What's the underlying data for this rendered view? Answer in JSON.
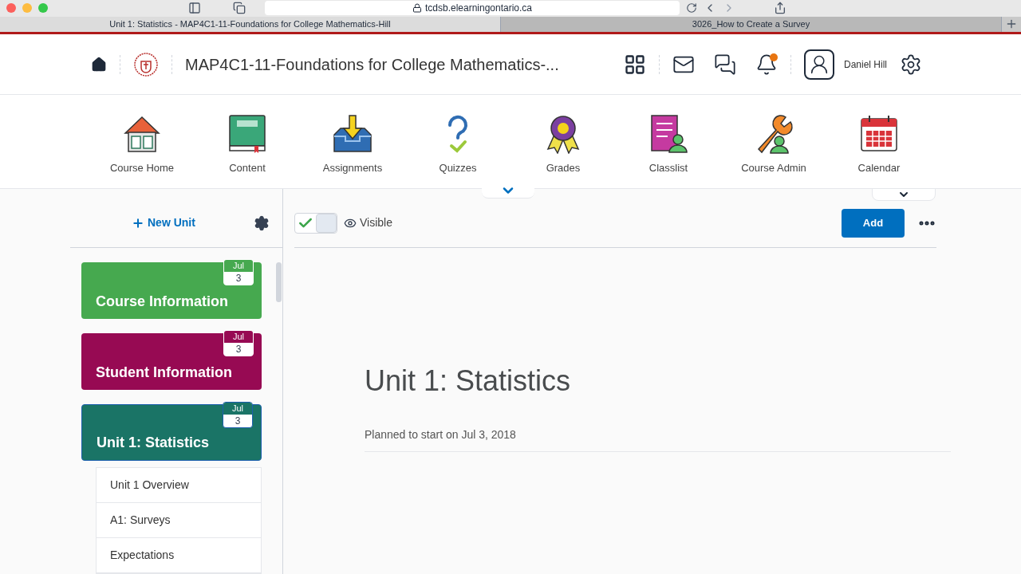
{
  "browser": {
    "address": "tcdsb.elearningontario.ca",
    "tabs": [
      {
        "label": "Unit 1: Statistics - MAP4C1-11-Foundations for College Mathematics-Hill",
        "selected": true
      },
      {
        "label": "3026_How to Create a Survey",
        "selected": false
      }
    ]
  },
  "header": {
    "course_title": "MAP4C1-11-Foundations for College Mathematics-...",
    "user_name": "Daniel Hill",
    "notification_unread": true
  },
  "nav": [
    {
      "kind": "home",
      "label": "Course Home"
    },
    {
      "kind": "content",
      "label": "Content"
    },
    {
      "kind": "assignments",
      "label": "Assignments"
    },
    {
      "kind": "quizzes",
      "label": "Quizzes"
    },
    {
      "kind": "grades",
      "label": "Grades"
    },
    {
      "kind": "classlist",
      "label": "Classlist"
    },
    {
      "kind": "admin",
      "label": "Course Admin"
    },
    {
      "kind": "calendar",
      "label": "Calendar"
    }
  ],
  "sidebar": {
    "new_unit": "New Unit",
    "units": [
      {
        "title": "Course Information",
        "month": "Jul",
        "day": "3",
        "color": "#46a94f",
        "selected": false
      },
      {
        "title": "Student Information",
        "month": "Jul",
        "day": "3",
        "color": "#970a53",
        "selected": false
      },
      {
        "title": "Unit 1: Statistics",
        "month": "Jul",
        "day": "3",
        "color": "#1a7466",
        "selected": true
      }
    ],
    "items": [
      "Unit 1 Overview",
      "A1: Surveys",
      "Expectations"
    ]
  },
  "toolbar": {
    "visible_on": true,
    "visible_label": "Visible",
    "add_button": "Add"
  },
  "unit": {
    "title": "Unit 1: Statistics",
    "planned": "Planned to start on Jul 3, 2018"
  }
}
